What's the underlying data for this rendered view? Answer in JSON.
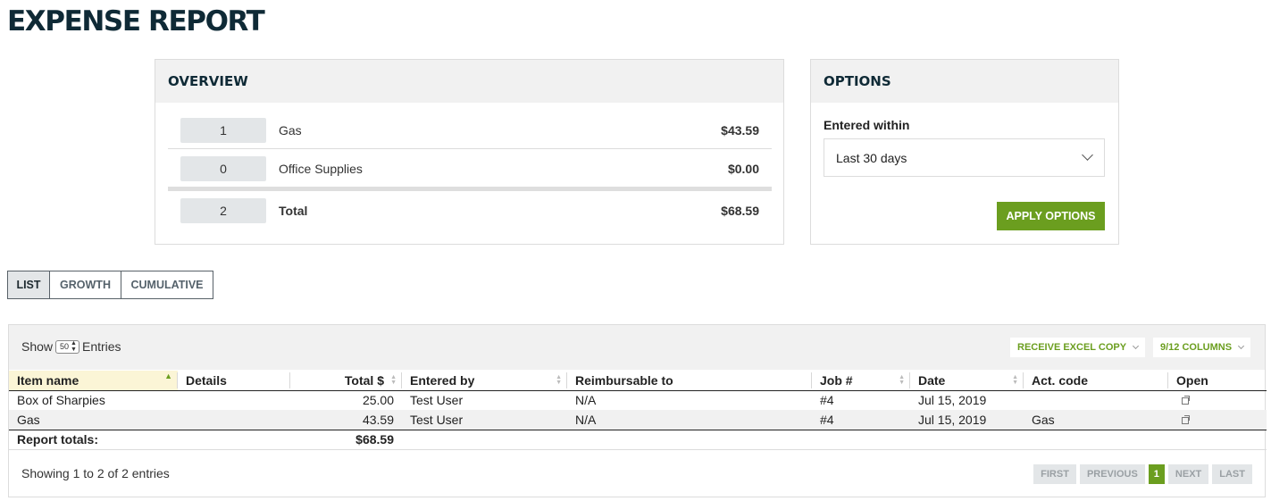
{
  "page": {
    "title": "EXPENSE REPORT"
  },
  "overview": {
    "title": "OVERVIEW",
    "rows": [
      {
        "count": "1",
        "label": "Gas",
        "amount": "$43.59"
      },
      {
        "count": "0",
        "label": "Office Supplies",
        "amount": "$0.00"
      }
    ],
    "total": {
      "count": "2",
      "label": "Total",
      "amount": "$68.59"
    }
  },
  "options": {
    "title": "OPTIONS",
    "entered_within_label": "Entered within",
    "entered_within_value": "Last 30 days",
    "apply_label": "APPLY OPTIONS"
  },
  "view_tabs": [
    {
      "label": "LIST",
      "active": true
    },
    {
      "label": "GROWTH",
      "active": false
    },
    {
      "label": "CUMULATIVE",
      "active": false
    }
  ],
  "table": {
    "show_label": "Show",
    "page_length": "50",
    "entries_label": "Entries",
    "excel_label": "RECEIVE EXCEL COPY",
    "columns_label": "9/12 COLUMNS",
    "columns": [
      "Item name",
      "Details",
      "Total $",
      "Entered by",
      "Reimbursable to",
      "Job #",
      "Date",
      "Act. code",
      "Open"
    ],
    "rows": [
      {
        "item": "Box of Sharpies",
        "details": "",
        "total": "25.00",
        "entered_by": "Test User",
        "reimbursable": "N/A",
        "job": "#4",
        "date": "Jul 15, 2019",
        "act_code": ""
      },
      {
        "item": "Gas",
        "details": "",
        "total": "43.59",
        "entered_by": "Test User",
        "reimbursable": "N/A",
        "job": "#4",
        "date": "Jul 15, 2019",
        "act_code": "Gas"
      }
    ],
    "totals_label": "Report totals:",
    "totals_value": "$68.59",
    "info": "Showing 1 to 2 of 2 entries",
    "pager": {
      "first": "FIRST",
      "previous": "PREVIOUS",
      "current": "1",
      "next": "NEXT",
      "last": "LAST"
    }
  },
  "colors": {
    "accent": "#6b9e1f",
    "title": "#0f2a36",
    "panel_head": "#f1f1f1"
  },
  "icons": {
    "sort_ascending": "triangle-up",
    "sort_both": "double-triangle",
    "open_row": "external-link-icon",
    "dropdown": "chevron-down-icon"
  }
}
